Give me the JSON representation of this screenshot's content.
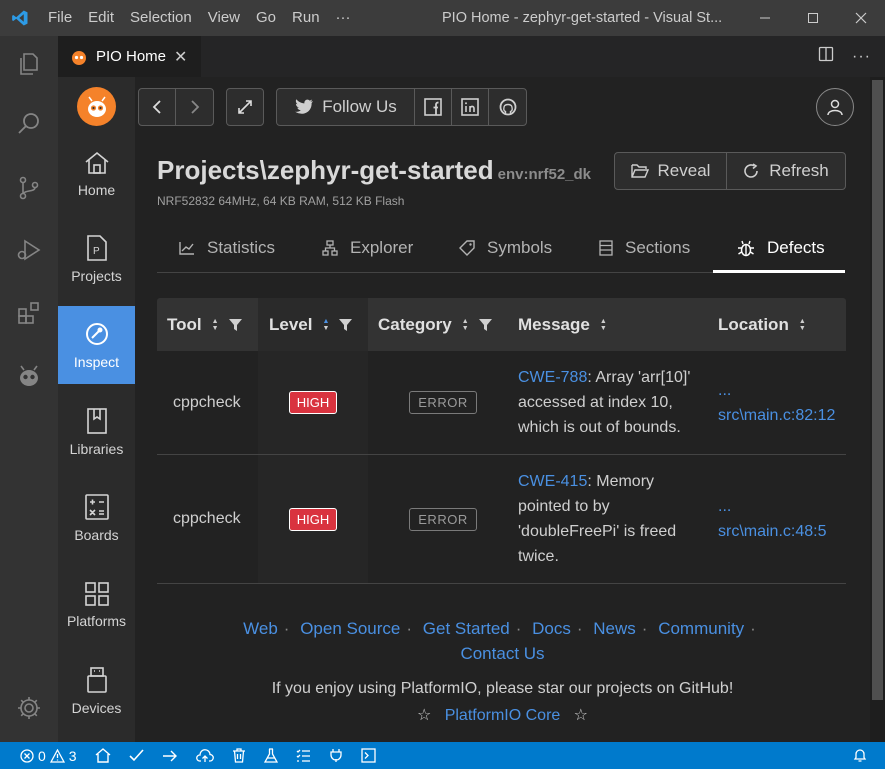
{
  "titlebar": {
    "menu": [
      "File",
      "Edit",
      "Selection",
      "View",
      "Go",
      "Run",
      "···"
    ],
    "title": "PIO Home - zephyr-get-started - Visual St..."
  },
  "editor_tab": {
    "label": "PIO Home"
  },
  "toolbar": {
    "follow_label": "Follow Us"
  },
  "sidebar": {
    "items": [
      {
        "label": "Home"
      },
      {
        "label": "Projects"
      },
      {
        "label": "Inspect"
      },
      {
        "label": "Libraries"
      },
      {
        "label": "Boards"
      },
      {
        "label": "Platforms"
      },
      {
        "label": "Devices"
      }
    ]
  },
  "project": {
    "title": "Projects\\zephyr-get-started",
    "env": "env:nrf52_dk",
    "specs": "NRF52832 64MHz, 64 KB RAM, 512 KB Flash",
    "reveal_label": "Reveal",
    "refresh_label": "Refresh"
  },
  "tabs": [
    "Statistics",
    "Explorer",
    "Symbols",
    "Sections",
    "Defects"
  ],
  "table": {
    "headers": [
      "Tool",
      "Level",
      "Category",
      "Message",
      "Location"
    ],
    "rows": [
      {
        "tool": "cppcheck",
        "level": "HIGH",
        "category": "ERROR",
        "cwe": "CWE-788",
        "message_lines": [
          ": Array 'arr[10]'",
          "accessed at index 10,",
          "which is out of bounds."
        ],
        "location_prefix": "...",
        "location": "src\\main.c:82:12"
      },
      {
        "tool": "cppcheck",
        "level": "HIGH",
        "category": "ERROR",
        "cwe": "CWE-415",
        "message_lines": [
          ": Memory",
          "pointed to by",
          "'doubleFreePi' is freed",
          "twice."
        ],
        "location_prefix": "...",
        "location": "src\\main.c:48:5"
      }
    ]
  },
  "footer": {
    "links": [
      "Web",
      "Open Source",
      "Get Started",
      "Docs",
      "News",
      "Community",
      "Contact Us"
    ],
    "note": "If you enjoy using PlatformIO, please star our projects on GitHub!",
    "core_label": "PlatformIO Core"
  },
  "statusbar": {
    "errors": "0",
    "warnings": "3"
  },
  "colors": {
    "accent": "#007acc",
    "active_nav": "#4a90e2",
    "high_badge": "#d9333f",
    "pio_orange": "#f5822a"
  }
}
